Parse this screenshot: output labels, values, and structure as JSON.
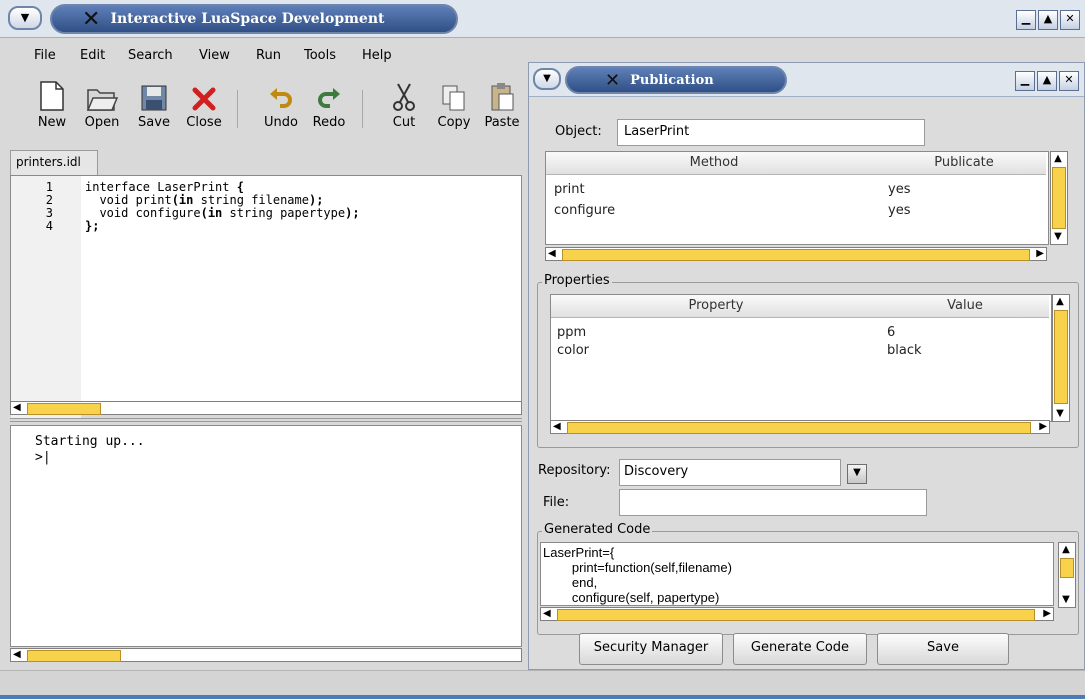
{
  "main_window": {
    "title": "Interactive LuaSpace Development",
    "menu": [
      "File",
      "Edit",
      "Search",
      "View",
      "Run",
      "Tools",
      "Help"
    ],
    "toolbar": [
      "New",
      "Open",
      "Save",
      "Close",
      "Undo",
      "Redo",
      "Cut",
      "Copy",
      "Paste"
    ],
    "tab": "printers.idl",
    "line_numbers": [
      "1",
      "2",
      "3",
      "4"
    ],
    "console": [
      "Starting up...",
      ">|"
    ]
  },
  "dialog": {
    "title": "Publication",
    "object_label": "Object:",
    "object_value": "LaserPrint",
    "methods": {
      "headers": [
        "Method",
        "Publicate"
      ],
      "rows": [
        [
          "print",
          "yes"
        ],
        [
          "configure",
          "yes"
        ]
      ]
    },
    "properties": {
      "group_label": "Properties",
      "headers": [
        "Property",
        "Value"
      ],
      "rows": [
        [
          "ppm",
          "6"
        ],
        [
          "color",
          "black"
        ]
      ]
    },
    "repository_label": "Repository:",
    "repository_value": "Discovery",
    "file_label": "File:",
    "file_value": "",
    "generated_label": "Generated Code",
    "buttons": [
      "Security Manager",
      "Generate Code",
      "Save"
    ]
  }
}
